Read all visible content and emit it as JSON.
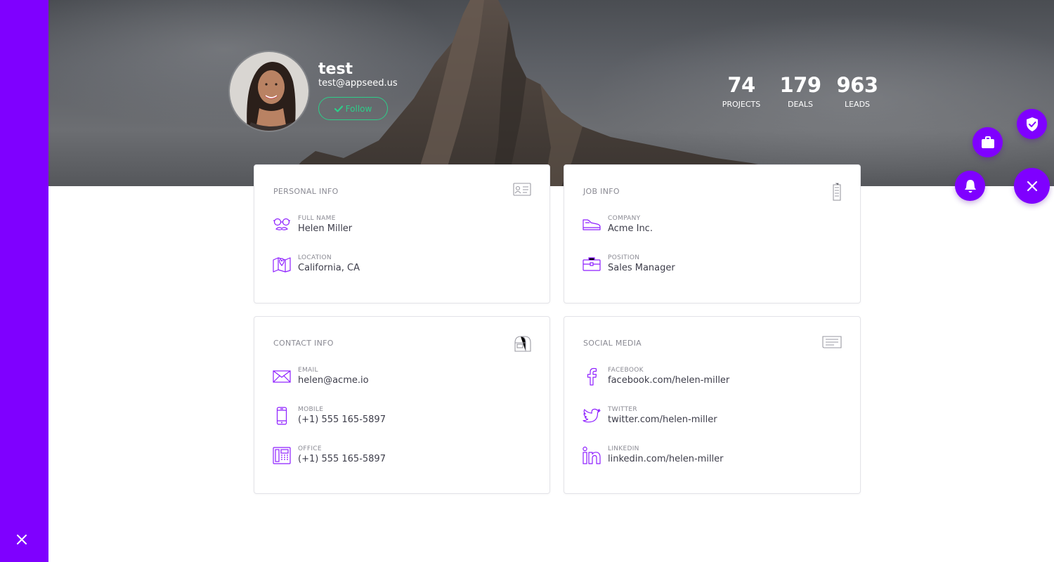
{
  "profile": {
    "name": "test",
    "email": "test@appseed.us",
    "follow_label": "Follow"
  },
  "stats": [
    {
      "value": "74",
      "label": "PROJECTS"
    },
    {
      "value": "179",
      "label": "DEALS"
    },
    {
      "value": "963",
      "label": "LEADS"
    }
  ],
  "personal": {
    "title": "PERSONAL INFO",
    "full_name_label": "FULL NAME",
    "full_name": "Helen Miller",
    "location_label": "LOCATION",
    "location": "California, CA"
  },
  "job": {
    "title": "JOB INFO",
    "company_label": "COMPANY",
    "company": "Acme Inc.",
    "position_label": "POSITION",
    "position": "Sales Manager"
  },
  "contact": {
    "title": "CONTACT INFO",
    "email_label": "EMAIL",
    "email": "helen@acme.io",
    "mobile_label": "MOBILE",
    "mobile": "(+1) 555 165-5897",
    "office_label": "OFFICE",
    "office": "(+1) 555 165-5897"
  },
  "social": {
    "title": "SOCIAL MEDIA",
    "facebook_label": "FACEBOOK",
    "facebook": "facebook.com/helen-miller",
    "twitter_label": "TWITTER",
    "twitter": "twitter.com/helen-miller",
    "linkedin_label": "LINKEDIN",
    "linkedin": "linkedin.com/helen-miller"
  },
  "colors": {
    "accent": "#7f00ff",
    "follow": "#2dce89",
    "text": "#3d3d4a",
    "muted": "#8a8a93"
  },
  "icons": [
    "close-icon",
    "check-icon",
    "id-card-icon",
    "building-icon",
    "mailbox-icon",
    "newspaper-icon",
    "glasses-mustache-icon",
    "map-icon",
    "shoe-icon",
    "briefcase-icon",
    "envelope-icon",
    "mobile-icon",
    "office-phone-icon",
    "facebook-icon",
    "twitter-icon",
    "linkedin-icon",
    "shield-check-icon",
    "bell-icon"
  ]
}
